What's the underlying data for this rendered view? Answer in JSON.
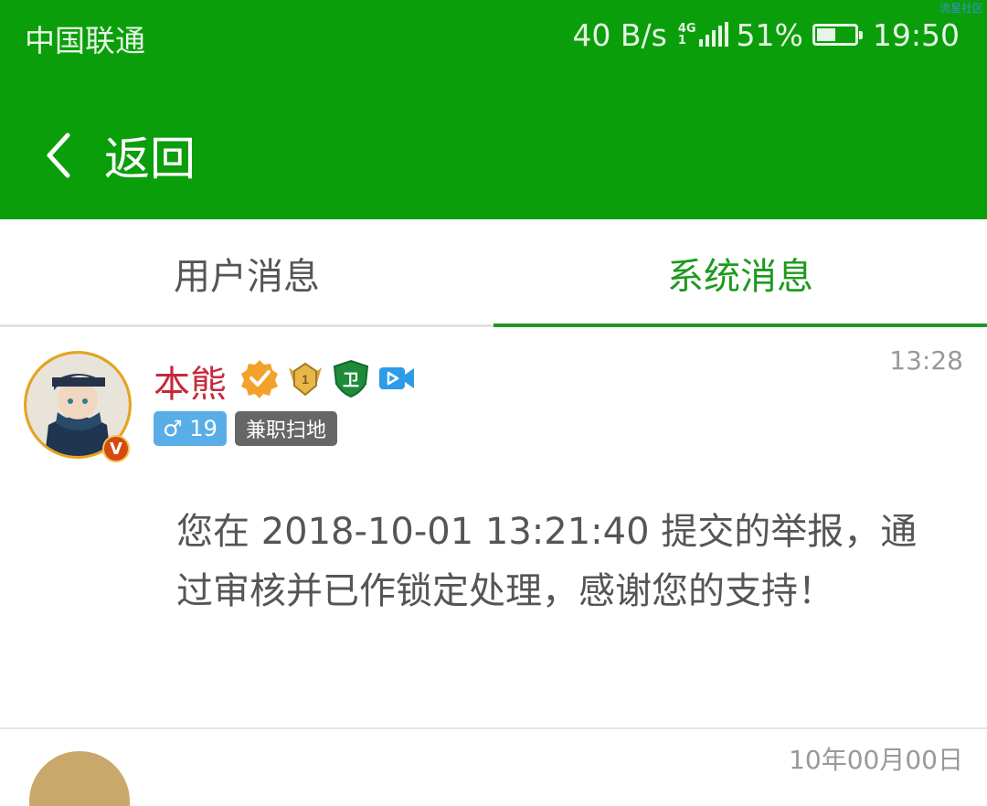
{
  "watermark": "流星社区",
  "status_bar": {
    "carrier": "中国联通",
    "net_speed": "40 B/s",
    "net_type_top": "4G",
    "net_type_bottom": "1",
    "battery_percent": "51%",
    "battery_level": 0.51,
    "time": "19:50"
  },
  "header": {
    "back_label": "返回"
  },
  "tabs": [
    {
      "label": "用户消息",
      "active": false
    },
    {
      "label": "系统消息",
      "active": true
    }
  ],
  "message": {
    "username": "本熊",
    "time": "13:28",
    "vip_badge": "V",
    "level_badge": "1",
    "guard_badge": "卫",
    "gender_tag": "♂ 19",
    "role_tag": "兼职扫地",
    "body": "您在 2018-10-01 13:21:40 提交的举报，通过审核并已作锁定处理，感谢您的支持！"
  },
  "next_message": {
    "time": "10年00月00日"
  },
  "colors": {
    "header_bg": "#0b9e0b",
    "active_tab": "#1d9a1d",
    "username": "#c8283a"
  }
}
